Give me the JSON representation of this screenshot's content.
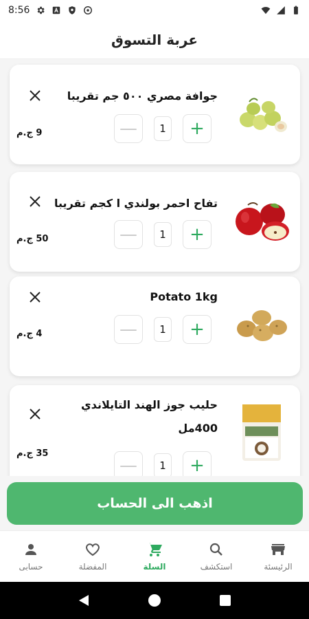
{
  "status_bar": {
    "time": "8:56",
    "left_icons": [
      "settings-icon",
      "notification-a-icon",
      "shield-icon",
      "vpn-icon"
    ],
    "right_icons": [
      "wifi-icon",
      "signal-icon",
      "battery-icon"
    ]
  },
  "header": {
    "title": "عربة التسوق"
  },
  "cart": {
    "items": [
      {
        "name": "جوافة مصري ٥٠٠ جم تقريبا",
        "name_lines": 1,
        "quantity": "1",
        "price": "9 ج.م",
        "image": "guava-image"
      },
      {
        "name": "تفاح احمر بولندي ا كجم تقريبا",
        "name_lines": 1,
        "quantity": "1",
        "price": "50 ج.م",
        "image": "apple-image"
      },
      {
        "name": "Potato 1kg",
        "name_lines": 1,
        "quantity": "1",
        "price": "4 ج.م",
        "image": "potato-image"
      },
      {
        "name": "حليب جوز الهند التايلاندي 400مل",
        "name_lines": 2,
        "quantity": "1",
        "price": "35 ج.م",
        "image": "coconut-milk-image"
      }
    ],
    "remove_icon": "close-icon",
    "minus_label": "—",
    "plus_label": "+"
  },
  "checkout": {
    "label": "اذهب الى الحساب"
  },
  "bottom_nav": {
    "items": [
      {
        "label": "الرئيسئة",
        "icon": "store-icon",
        "active": false
      },
      {
        "label": "استكشف",
        "icon": "search-icon",
        "active": false
      },
      {
        "label": "السلة",
        "icon": "cart-icon",
        "active": true
      },
      {
        "label": "المفضلة",
        "icon": "heart-icon",
        "active": false
      },
      {
        "label": "حسابى",
        "icon": "person-icon",
        "active": false
      }
    ]
  },
  "colors": {
    "accent": "#4fb76f",
    "accent_dark": "#2eaa5f",
    "background": "#f5f5f5",
    "card": "#ffffff"
  }
}
